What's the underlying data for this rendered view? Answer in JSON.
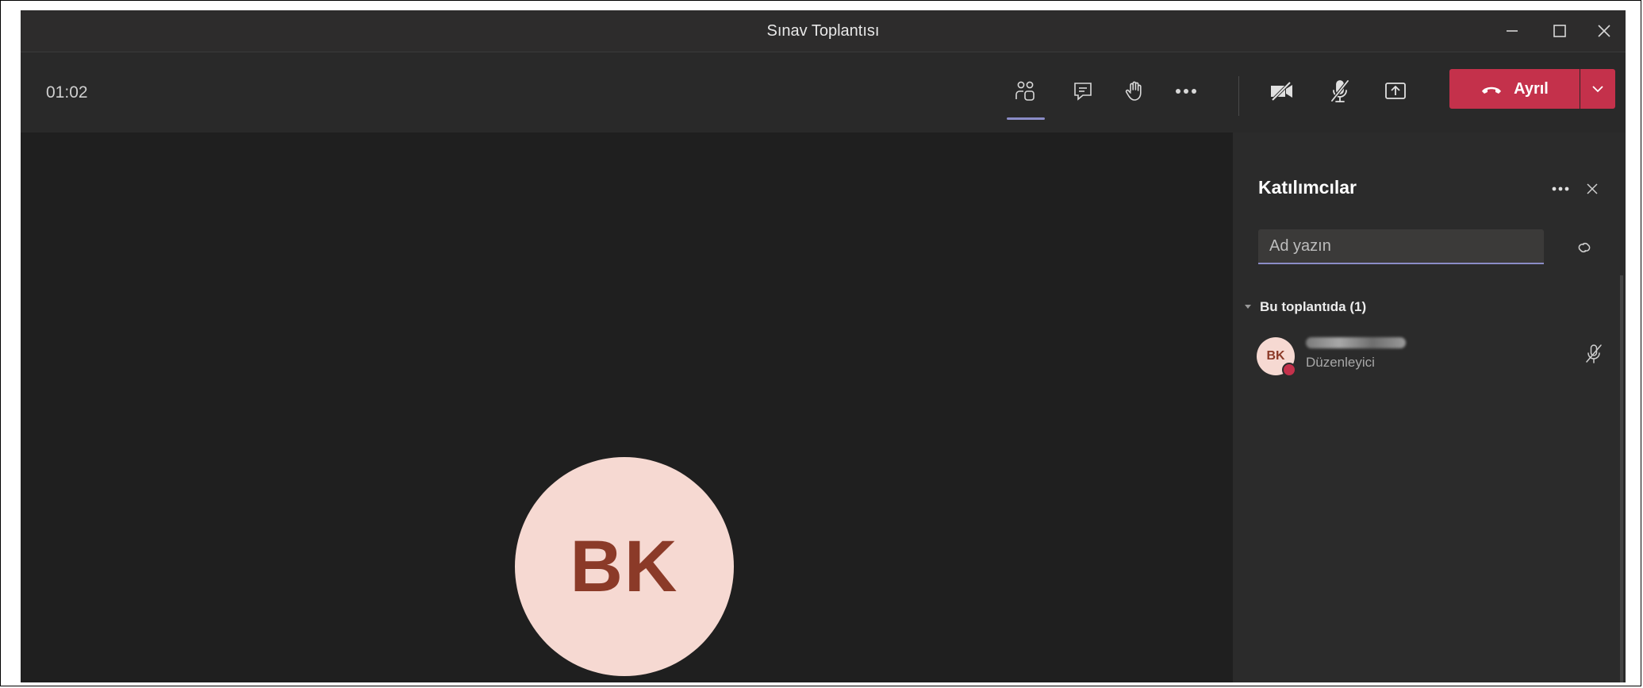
{
  "window": {
    "title": "Sınav Toplantısı"
  },
  "toolbar": {
    "timer": "01:02",
    "leave_label": "Ayrıl",
    "icons": [
      "people-icon",
      "chat-icon",
      "raise-hand-icon",
      "more-options-icon",
      "camera-off-icon",
      "mic-off-icon",
      "share-screen-icon"
    ]
  },
  "stage": {
    "avatar_initials": "BK"
  },
  "panel": {
    "title": "Katılımcılar",
    "search_placeholder": "Ad yazın",
    "section_label": "Bu toplantıda (1)",
    "participants": [
      {
        "initials": "BK",
        "role": "Düzenleyici",
        "status_color": "#c4314b",
        "muted": true
      }
    ]
  },
  "colors": {
    "accent": "#8b8cc7",
    "leave": "#c4314b",
    "avatar_bg": "#f6d9d2",
    "avatar_text": "#8b3a28"
  }
}
